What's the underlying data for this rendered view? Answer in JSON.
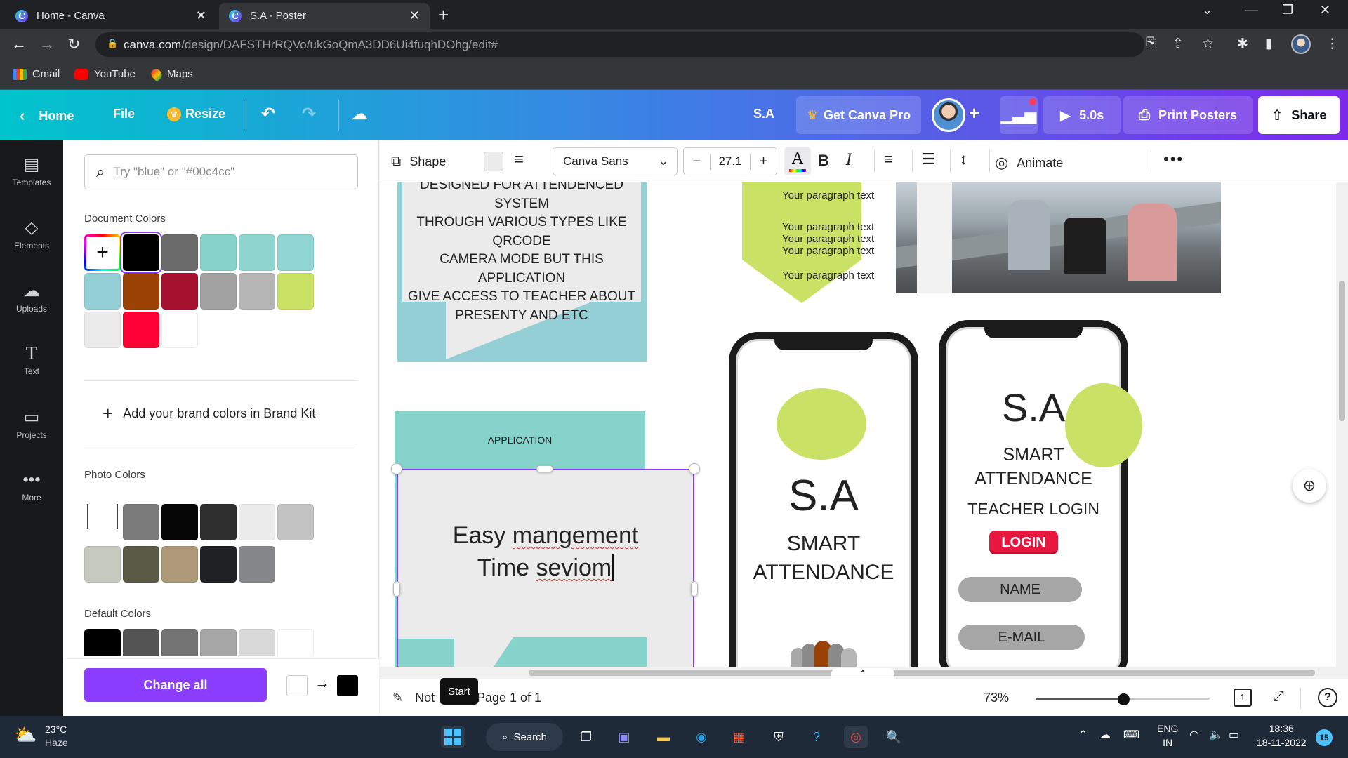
{
  "browser": {
    "tabs": [
      {
        "title": "Home - Canva",
        "active": false
      },
      {
        "title": "S.A - Poster",
        "active": true
      }
    ],
    "url_host": "canva.com",
    "url_path": "/design/DAFSTHrRQVo/ukGoQmA3DD6Ui4fuqhDOhg/edit#",
    "bookmarks": [
      "Gmail",
      "YouTube",
      "Maps"
    ]
  },
  "header": {
    "home": "Home",
    "file": "File",
    "resize": "Resize",
    "doc_title": "S.A",
    "get_pro": "Get Canva Pro",
    "duration": "5.0s",
    "print": "Print Posters",
    "share": "Share"
  },
  "rail": [
    {
      "label": "Templates",
      "icon": "templates-icon"
    },
    {
      "label": "Elements",
      "icon": "elements-icon"
    },
    {
      "label": "Uploads",
      "icon": "uploads-icon"
    },
    {
      "label": "Text",
      "icon": "text-icon"
    },
    {
      "label": "Projects",
      "icon": "projects-icon"
    },
    {
      "label": "More",
      "icon": "more-icon"
    }
  ],
  "panel": {
    "search_placeholder": "Try \"blue\" or \"#00c4cc\"",
    "document_colors_title": "Document Colors",
    "document_colors": [
      "#000000",
      "#6b6b6b",
      "#85d3ca",
      "#8ed5cf",
      "#8fd6d3",
      "#95cfd6",
      "#9b4306",
      "#a5112e",
      "#a2a2a2",
      "#b5b5b6",
      "#c9e265",
      "#ebebeb",
      "#ff0034",
      "#ffffff"
    ],
    "brand_kit": "Add your brand colors in Brand Kit",
    "photo_colors_title": "Photo Colors",
    "photo_colors": [
      "#7a7a7a",
      "#050505",
      "#2f2f2f",
      "#ececec",
      "#c4c4c4",
      "#c6c9be",
      "#5b5a45",
      "#ad9877",
      "#202124",
      "#85868a"
    ],
    "default_colors_title": "Default Colors",
    "default_colors": [
      "#000000",
      "#545454",
      "#737373",
      "#a6a6a6",
      "#d9d9d9",
      "#ffffff"
    ],
    "change_all": "Change all"
  },
  "toolbar": {
    "shape": "Shape",
    "font": "Canva Sans",
    "font_size": "27.1",
    "animate": "Animate"
  },
  "canvas": {
    "body_text": [
      "DESIGNED FOR ATTENDENCED SYSTEM",
      "THROUGH VARIOUS TYPES LIKE QRCODE",
      "CAMERA MODE BUT THIS APPLICATION",
      "GIVE ACCESS TO TEACHER ABOUT",
      "PRESENTY AND ETC"
    ],
    "paragraph": "Your paragraph text",
    "application": "APPLICATION",
    "easy_line1_a": "Easy ",
    "easy_line1_b": "mangement",
    "easy_line2_a": "Time ",
    "easy_line2_b": "seviom",
    "phone1_title": "S.A",
    "phone1_sub1": "SMART",
    "phone1_sub2": "ATTENDANCE",
    "phone2_title": "S.A",
    "phone2_sub1": "SMART",
    "phone2_sub2": "ATTENDANCE",
    "teacher_login": "TEACHER LOGIN",
    "login_btn": "LOGIN",
    "name_field": "NAME",
    "email_field": "E-MAIL"
  },
  "bottom": {
    "notes": "Not",
    "tooltip": "Start",
    "page": "Page 1 of 1",
    "zoom": "73%",
    "zoom_level_percent": 73,
    "page_count": "1"
  },
  "taskbar": {
    "temp": "23°C",
    "weather": "Haze",
    "search": "Search",
    "lang1": "ENG",
    "lang2": "IN",
    "time": "18:36",
    "date": "18-11-2022",
    "notifications": "15"
  },
  "colors": {
    "purple": "#8b3dff",
    "teal": "#85d3ca",
    "lime": "#c9e265",
    "login_red": "#e8173f"
  }
}
